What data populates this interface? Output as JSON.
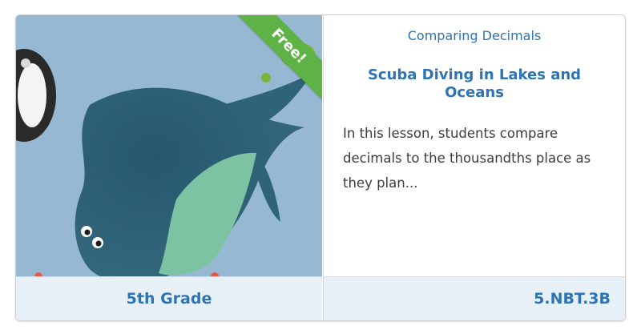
{
  "card": {
    "badge": "Free!",
    "grade": "5th Grade",
    "topic": "Comparing Decimals",
    "title": "Scuba Diving in Lakes and Oceans",
    "description": "In this lesson, students compare decimals to the thousandths place as they plan...",
    "standard": "5.NBT.3B"
  },
  "colors": {
    "accent": "#2e74b5",
    "ribbon": "#5fb346",
    "footer": "#e8f0f7",
    "water": "#97b8d3",
    "stingray": "#2f6478",
    "stingray_belly": "#7cc3a4"
  },
  "illustration": {
    "icons": [
      "stingray-icon",
      "turtle-icon",
      "fish-icon",
      "coral-icon"
    ]
  }
}
